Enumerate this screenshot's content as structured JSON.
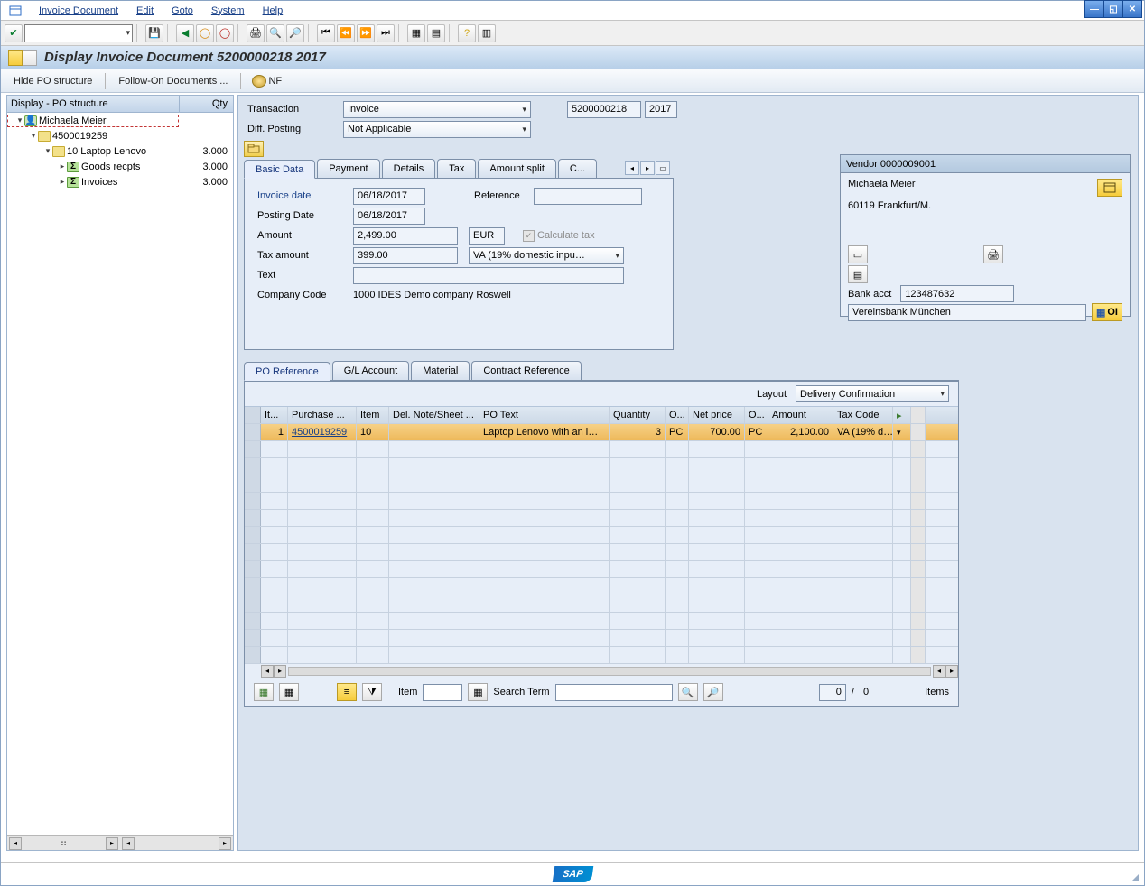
{
  "menu": {
    "items": [
      "Invoice Document",
      "Edit",
      "Goto",
      "System",
      "Help"
    ]
  },
  "title": "Display Invoice Document 5200000218 2017",
  "app_toolbar": {
    "hide_po": "Hide PO structure",
    "follow_on": "Follow-On Documents ...",
    "nf": "NF"
  },
  "po_structure": {
    "header_col1": "Display - PO structure",
    "header_col2": "Qty",
    "rows": [
      {
        "indent": 0,
        "expander": "▾",
        "icon": "person",
        "label": "Michaela Meier",
        "qty": "",
        "selected": true
      },
      {
        "indent": 1,
        "expander": "▾",
        "icon": "folder",
        "label": "4500019259",
        "qty": ""
      },
      {
        "indent": 2,
        "expander": "▾",
        "icon": "folder",
        "label": "10 Laptop Lenovo",
        "qty": "3.000"
      },
      {
        "indent": 3,
        "expander": "▸",
        "icon": "sigma",
        "label": "Goods recpts",
        "qty": "3.000"
      },
      {
        "indent": 3,
        "expander": "▸",
        "icon": "sigma",
        "label": "Invoices",
        "qty": "3.000"
      }
    ]
  },
  "header_form": {
    "transaction_label": "Transaction",
    "transaction_value": "Invoice",
    "doc_number": "5200000218",
    "fiscal_year": "2017",
    "diff_posting_label": "Diff. Posting",
    "diff_posting_value": "Not Applicable"
  },
  "tabs_top": {
    "items": [
      "Basic Data",
      "Payment",
      "Details",
      "Tax",
      "Amount split",
      "C..."
    ],
    "active": 0
  },
  "basic_data": {
    "invoice_date_label": "Invoice date",
    "invoice_date": "06/18/2017",
    "reference_label": "Reference",
    "reference": "",
    "posting_date_label": "Posting Date",
    "posting_date": "06/18/2017",
    "amount_label": "Amount",
    "amount": "2,499.00",
    "currency": "EUR",
    "calculate_tax_label": "Calculate tax",
    "tax_amount_label": "Tax amount",
    "tax_amount": "399.00",
    "tax_code": "VA (19% domestic inpu…",
    "text_label": "Text",
    "text": "",
    "company_code_label": "Company Code",
    "company_code": "1000 IDES Demo company Roswell"
  },
  "vendor": {
    "title": "Vendor 0000009001",
    "name": "Michaela Meier",
    "city": "60119 Frankfurt/M.",
    "bank_acct_label": "Bank acct",
    "bank_acct": "123487632",
    "bank_name": "Vereinsbank München",
    "oi": "OI"
  },
  "tabs_bottom": {
    "items": [
      "PO Reference",
      "G/L Account",
      "Material",
      "Contract Reference"
    ],
    "active": 0
  },
  "grid": {
    "layout_label": "Layout",
    "layout_value": "Delivery Confirmation",
    "columns": [
      "It...",
      "Purchase ...",
      "Item",
      "Del. Note/Sheet ...",
      "PO Text",
      "Quantity",
      "O...",
      "Net price",
      "O...",
      "Amount",
      "Tax Code"
    ],
    "widths": [
      30,
      76,
      36,
      100,
      144,
      62,
      26,
      62,
      26,
      72,
      66
    ],
    "rows": [
      {
        "it": "1",
        "po": "4500019259",
        "item": "10",
        "del": "",
        "text": "Laptop Lenovo with an i…",
        "qty": "3",
        "ou1": "PC",
        "price": "700.00",
        "ou2": "PC",
        "amount": "2,100.00",
        "tax": "VA (19% d…"
      }
    ],
    "footer": {
      "item_label": "Item",
      "search_label": "Search Term",
      "count_curr": "0",
      "count_sep": "/",
      "count_total": "0",
      "items_label": "Items"
    }
  },
  "sap_logo": "SAP"
}
